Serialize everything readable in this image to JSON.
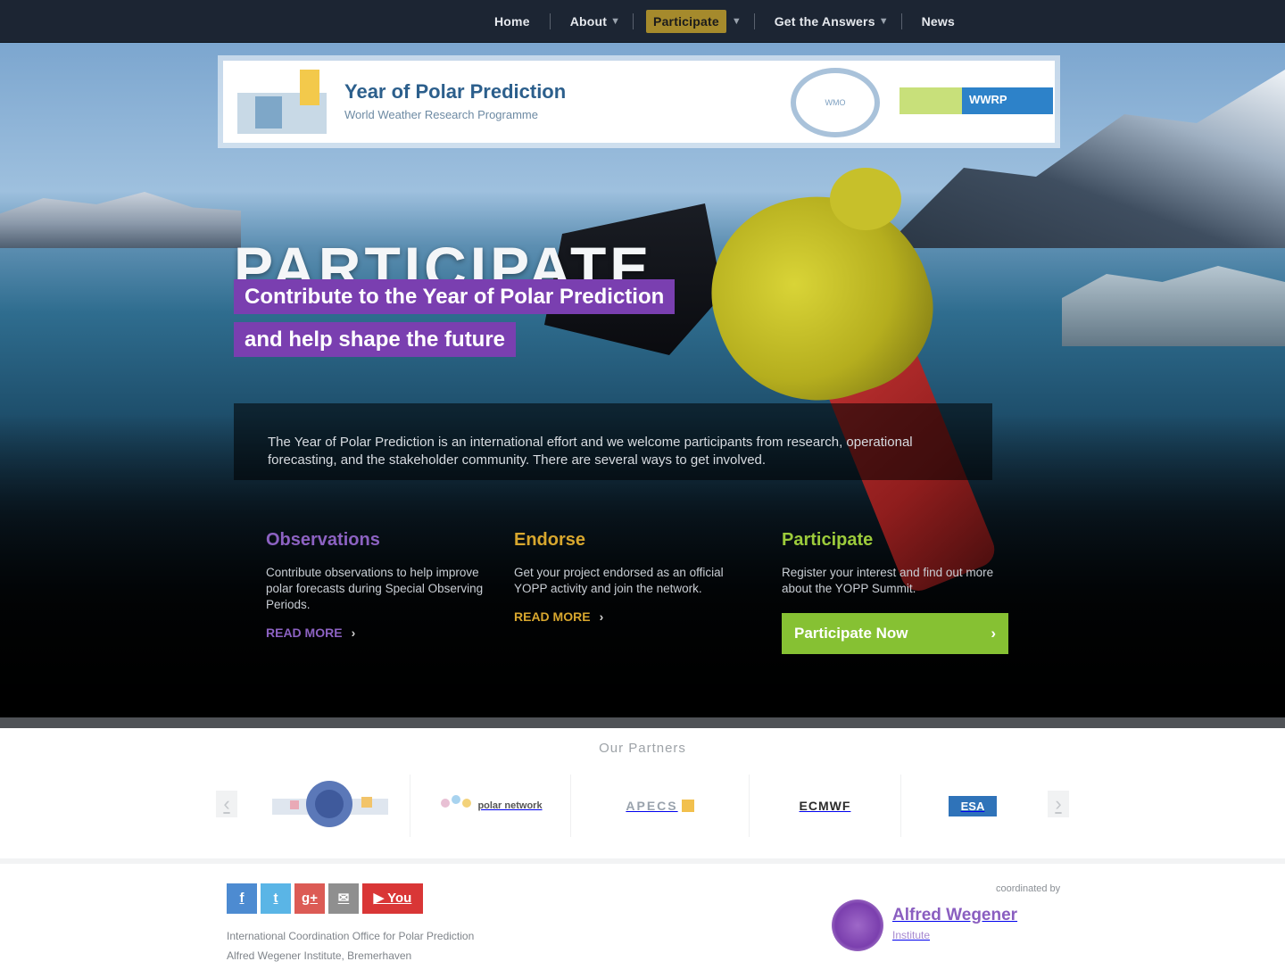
{
  "nav": {
    "items": [
      {
        "label": "Home",
        "active": false
      },
      {
        "label": "About",
        "active": false,
        "has_dropdown": true
      },
      {
        "label": "Participate",
        "active": true,
        "has_dropdown": true
      },
      {
        "label": "Get the Answers",
        "active": false,
        "has_dropdown": true
      },
      {
        "label": "News",
        "active": false
      }
    ],
    "active_color": "#a58a2c"
  },
  "header": {
    "title": "Year of Polar Prediction",
    "subtitle": "World Weather Research Programme",
    "emblem_text": "WMO",
    "partner_logo_text": "WWRP"
  },
  "hero": {
    "title": "PARTICIPATE",
    "subtitle_lines": [
      "Contribute to the Year of Polar Prediction",
      "and help shape the future"
    ],
    "intro": "The Year of Polar Prediction is an international effort and we welcome participants from research, operational forecasting, and the stakeholder community. There are several ways to get involved.",
    "columns": [
      {
        "heading": "Observations",
        "text": "Contribute observations to help improve polar forecasts during Special Observing Periods.",
        "link": "READ MORE",
        "color": "#8c62c2"
      },
      {
        "heading": "Endorse",
        "text": "Get your project endorsed as an official YOPP activity and join the network.",
        "link": "READ MORE",
        "color": "#d8a72e"
      },
      {
        "heading": "Participate",
        "text": "Register your interest and find out more about the YOPP Summit.",
        "button": "Participate Now",
        "color": "#86c133"
      }
    ]
  },
  "partners": {
    "title": "Our Partners",
    "logos": [
      {
        "name": "wmo-logo",
        "label": ""
      },
      {
        "name": "polar-network-logo",
        "label": "polar network"
      },
      {
        "name": "apecs-logo",
        "label": "APECS"
      },
      {
        "name": "ecmwf-logo",
        "label": "ECMWF"
      },
      {
        "name": "esa-logo",
        "label": "ESA"
      }
    ]
  },
  "footer": {
    "social": [
      {
        "name": "facebook-icon",
        "glyph": "f"
      },
      {
        "name": "twitter-icon",
        "glyph": "t"
      },
      {
        "name": "googleplus-icon",
        "glyph": "g+"
      },
      {
        "name": "email-icon",
        "glyph": "✉"
      },
      {
        "name": "youtube-icon",
        "glyph": "▶ You"
      }
    ],
    "text_line1": "International Coordination Office for Polar Prediction",
    "text_line2": "Alfred Wegener Institute, Bremerhaven",
    "coordinated_by": "coordinated by",
    "coord_name": "Alfred Wegener",
    "coord_sub": "Institute"
  }
}
